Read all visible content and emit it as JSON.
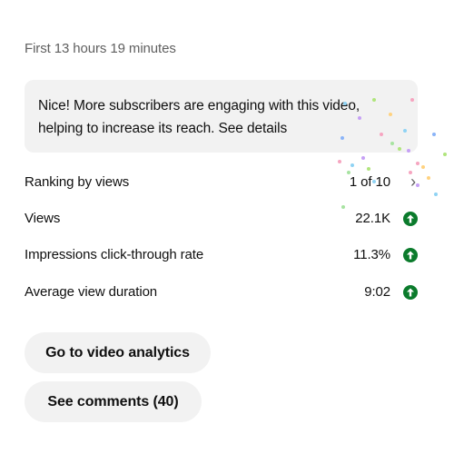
{
  "period_label": "First 13 hours 19 minutes",
  "banner": {
    "line1": "Nice! More subscribers are engaging with this video,",
    "line2_text": "helping to increase its reach.",
    "details_link": "See details"
  },
  "metrics": [
    {
      "label": "Ranking by views",
      "value": "1 of 10",
      "indicator": "chevron-right-icon"
    },
    {
      "label": "Views",
      "value": "22.1K",
      "indicator": "trend-up-icon"
    },
    {
      "label": "Impressions click-through rate",
      "value": "11.3%",
      "indicator": "trend-up-icon"
    },
    {
      "label": "Average view duration",
      "value": "9:02",
      "indicator": "trend-up-icon"
    }
  ],
  "buttons": {
    "analytics": "Go to video analytics",
    "comments": "See comments (40)"
  },
  "colors": {
    "trend_up": "#0b7b2c",
    "chip_bg": "#f2f2f2",
    "secondary_text": "#606060"
  }
}
